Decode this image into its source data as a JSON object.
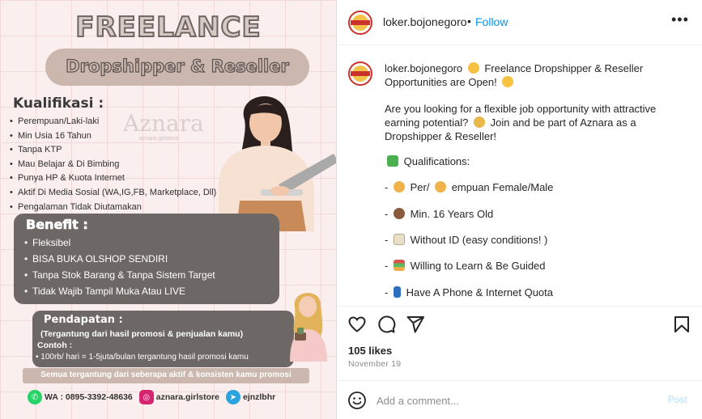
{
  "poster": {
    "title": "FREELANCE",
    "subtitle": "Dropshipper & Reseller",
    "qualifications_heading": "Kualifikasi :",
    "qualifications": [
      "Perempuan/Laki-laki",
      "Min Usia 16 Tahun",
      "Tanpa KTP",
      "Mau Belajar & Di Bimbing",
      "Punya HP & Kuota Internet",
      "Aktif Di Media Sosial (WA,IG,FB, Marketplace, Dll)",
      "Pengalaman Tidak Diutamakan"
    ],
    "watermark": "Aznara",
    "watermark_small": "aznara.girlstore",
    "benefit_heading": "Benefit :",
    "benefits": [
      "Fleksibel",
      "BISA BUKA OLSHOP SENDIRI",
      "Tanpa Stok Barang & Tanpa Sistem Target",
      "Tidak Wajib Tampil Muka Atau LIVE"
    ],
    "income_heading": "Pendapatan :",
    "income_note": "(Tergantung dari hasil promosi & penjualan kamu)",
    "example_heading": "Contoh :",
    "example_text": "• 100rb/ hari = 1-5juta/bulan tergantung hasil promosi kamu",
    "footer_note": "Semua tergantung dari seberapa aktif & konsisten kamu promosi",
    "contacts": {
      "whatsapp": "WA : 0895-3392-48636",
      "instagram": "aznara.girlstore",
      "telegram": "ejnzlbhr"
    },
    "colors": {
      "accent": "#cbb7ad",
      "dark_box": "#6d6766",
      "background": "#fbeeee"
    }
  },
  "post": {
    "username": "loker.bojonegoro",
    "separator": "•",
    "follow_label": "Follow",
    "more_label": "•••",
    "caption": {
      "username": "loker.bojonegoro",
      "intro": "Freelance Dropshipper & Reseller Opportunities are Open!",
      "paragraph": "Are you looking for a flexible job opportunity with attractive earning potential?",
      "paragraph_2": "Join and be part of Aznara as a Dropshipper & Reseller!",
      "qualifications_label": "Qualifications:",
      "items": [
        {
          "prefix": "-",
          "pre": "Per/",
          "text": "empuan Female/Male"
        },
        {
          "prefix": "-",
          "pre": "",
          "text": "Min. 16 Years Old"
        },
        {
          "prefix": "-",
          "pre": "",
          "text": "Without ID (easy conditions! )"
        },
        {
          "prefix": "-",
          "pre": "",
          "text": "Willing to Learn & Be Guided"
        },
        {
          "prefix": "-",
          "pre": "",
          "text": "Have A Phone & Internet Quota"
        }
      ]
    },
    "likes": "105 likes",
    "date": "November 19",
    "comment_placeholder": "Add a comment...",
    "post_label": "Post",
    "colors": {
      "link": "#0095f6",
      "post_disabled": "#b2dffc",
      "muted": "#8e8e8e"
    }
  }
}
